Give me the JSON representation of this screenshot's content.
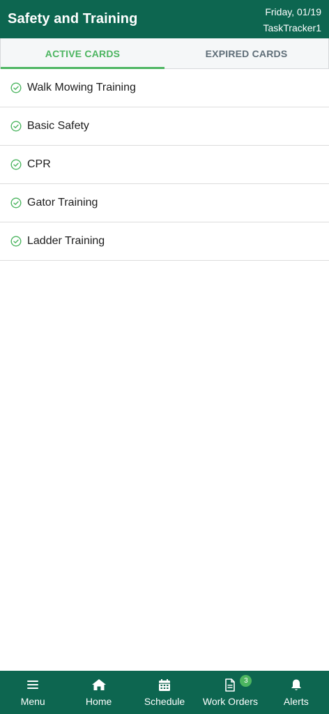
{
  "header": {
    "title": "Safety and Training",
    "date": "Friday, 01/19",
    "user": "TaskTracker1"
  },
  "tabs": [
    {
      "label": "ACTIVE CARDS",
      "active": true
    },
    {
      "label": "EXPIRED CARDS",
      "active": false
    }
  ],
  "cards": [
    {
      "label": "Walk Mowing Training",
      "icon": "check-circle-icon"
    },
    {
      "label": "Basic Safety",
      "icon": "check-circle-icon"
    },
    {
      "label": "CPR",
      "icon": "check-circle-icon"
    },
    {
      "label": "Gator Training",
      "icon": "check-circle-icon"
    },
    {
      "label": "Ladder Training",
      "icon": "check-circle-icon"
    }
  ],
  "bottom_nav": {
    "menu": {
      "label": "Menu",
      "icon": "menu-icon"
    },
    "home": {
      "label": "Home",
      "icon": "home-icon"
    },
    "schedule": {
      "label": "Schedule",
      "icon": "calendar-icon"
    },
    "work_orders": {
      "label": "Work Orders",
      "icon": "document-icon",
      "badge": "3"
    },
    "alerts": {
      "label": "Alerts",
      "icon": "bell-icon"
    }
  },
  "colors": {
    "brand": "#0d6650",
    "accent": "#4cb560",
    "tab_inactive": "#5f6e78"
  }
}
